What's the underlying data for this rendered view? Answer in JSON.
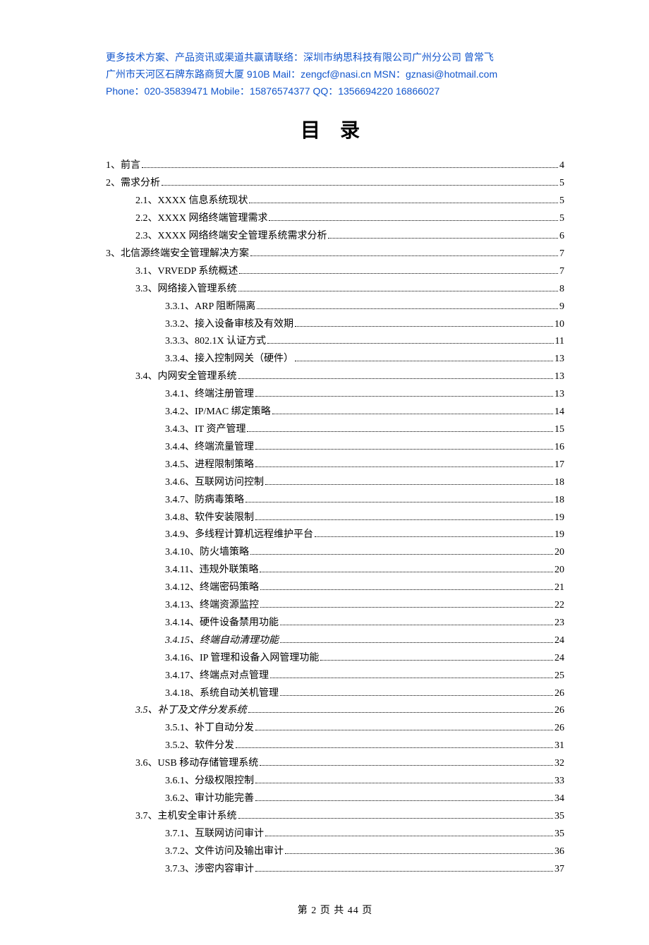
{
  "header": {
    "line1": "更多技术方案、产品资讯或渠道共赢请联络：深圳市纳思科技有限公司广州分公司    曾常飞",
    "line2": "广州市天河区石牌东路商贸大厦 910B    Mail：zengcf@nasi.cn    MSN：gznasi@hotmail.com",
    "line3": "Phone：020-35839471    Mobile：15876574377           QQ：1356694220 16866027"
  },
  "toc_title": "目录",
  "toc": [
    {
      "level": 0,
      "label": "1、前言",
      "page": "4"
    },
    {
      "level": 0,
      "label": "2、需求分析",
      "page": "5"
    },
    {
      "level": 1,
      "label": "2.1、XXXX 信息系统现状",
      "page": "5"
    },
    {
      "level": 1,
      "label": "2.2、XXXX 网络终端管理需求",
      "page": "5"
    },
    {
      "level": 1,
      "label": "2.3、XXXX 网络终端安全管理系统需求分析",
      "page": "6"
    },
    {
      "level": 0,
      "label": "3、北信源终端安全管理解决方案",
      "page": "7"
    },
    {
      "level": 1,
      "label": "3.1、VRVEDP 系统概述",
      "page": "7"
    },
    {
      "level": 1,
      "label": "3.3、网络接入管理系统",
      "page": "8"
    },
    {
      "level": 2,
      "label": "3.3.1、ARP 阻断隔离",
      "page": "9"
    },
    {
      "level": 2,
      "label": "3.3.2、接入设备审核及有效期",
      "page": "10"
    },
    {
      "level": 2,
      "label": "3.3.3、802.1X 认证方式",
      "page": "11"
    },
    {
      "level": 2,
      "label": "3.3.4、接入控制网关（硬件）",
      "page": "13"
    },
    {
      "level": 1,
      "label": "3.4、内网安全管理系统",
      "page": "13"
    },
    {
      "level": 2,
      "label": "3.4.1、终端注册管理",
      "page": "13"
    },
    {
      "level": 2,
      "label": "3.4.2、IP/MAC 绑定策略",
      "page": "14"
    },
    {
      "level": 2,
      "label": "3.4.3、IT 资产管理",
      "page": "15"
    },
    {
      "level": 2,
      "label": "3.4.4、终端流量管理",
      "page": "16"
    },
    {
      "level": 2,
      "label": "3.4.5、进程限制策略",
      "page": "17"
    },
    {
      "level": 2,
      "label": "3.4.6、互联网访问控制",
      "page": "18"
    },
    {
      "level": 2,
      "label": "3.4.7、防病毒策略",
      "page": "18"
    },
    {
      "level": 2,
      "label": "3.4.8、软件安装限制",
      "page": "19"
    },
    {
      "level": 2,
      "label": "3.4.9、多线程计算机远程维护平台",
      "page": "19"
    },
    {
      "level": 2,
      "label": "3.4.10、防火墙策略",
      "page": "20"
    },
    {
      "level": 2,
      "label": "3.4.11、违规外联策略",
      "page": "20"
    },
    {
      "level": 2,
      "label": "3.4.12、终端密码策略",
      "page": "21"
    },
    {
      "level": 2,
      "label": "3.4.13、终端资源监控",
      "page": "22"
    },
    {
      "level": 2,
      "label": "3.4.14、硬件设备禁用功能",
      "page": "23"
    },
    {
      "level": 2,
      "italic": true,
      "label": "3.4.15、终端自动清理功能",
      "page": "24"
    },
    {
      "level": 2,
      "label": "3.4.16、IP 管理和设备入网管理功能",
      "page": "24"
    },
    {
      "level": 2,
      "label": "3.4.17、终端点对点管理",
      "page": "25"
    },
    {
      "level": 2,
      "label": "3.4.18、系统自动关机管理",
      "page": "26"
    },
    {
      "level": 1,
      "italic": true,
      "label": "3.5、补丁及文件分发系统",
      "page": "26"
    },
    {
      "level": 2,
      "label": "3.5.1、补丁自动分发",
      "page": "26"
    },
    {
      "level": 2,
      "label": "3.5.2、软件分发",
      "page": "31"
    },
    {
      "level": 1,
      "label": "3.6、USB 移动存储管理系统",
      "page": "32"
    },
    {
      "level": 2,
      "label": "3.6.1、分级权限控制",
      "page": "33"
    },
    {
      "level": 2,
      "label": "3.6.2、审计功能完善",
      "page": "34"
    },
    {
      "level": 1,
      "label": "3.7、主机安全审计系统",
      "page": "35"
    },
    {
      "level": 2,
      "label": "3.7.1、互联网访问审计",
      "page": "35"
    },
    {
      "level": 2,
      "label": "3.7.2、文件访问及输出审计",
      "page": "36"
    },
    {
      "level": 2,
      "label": "3.7.3、涉密内容审计",
      "page": "37"
    }
  ],
  "footer": "第  2  页  共  44  页"
}
